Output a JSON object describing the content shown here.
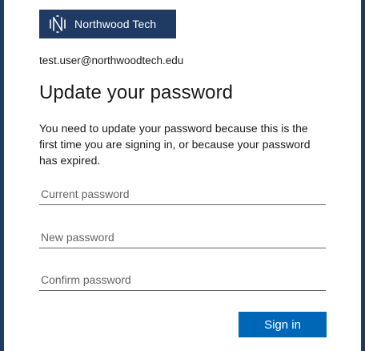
{
  "brand": {
    "name": "Northwood Tech",
    "logo_icon": "northwood-logo-icon",
    "color": "#1f3a63"
  },
  "identity": "test.user@northwoodtech.edu",
  "title": "Update your password",
  "description": "You need to update your password because this is the first time you are signing in, or because your password has expired.",
  "fields": {
    "current_password": {
      "placeholder": "Current password",
      "value": ""
    },
    "new_password": {
      "placeholder": "New password",
      "value": ""
    },
    "confirm_password": {
      "placeholder": "Confirm password",
      "value": ""
    }
  },
  "submit": {
    "label": "Sign in",
    "color": "#0067b8"
  }
}
